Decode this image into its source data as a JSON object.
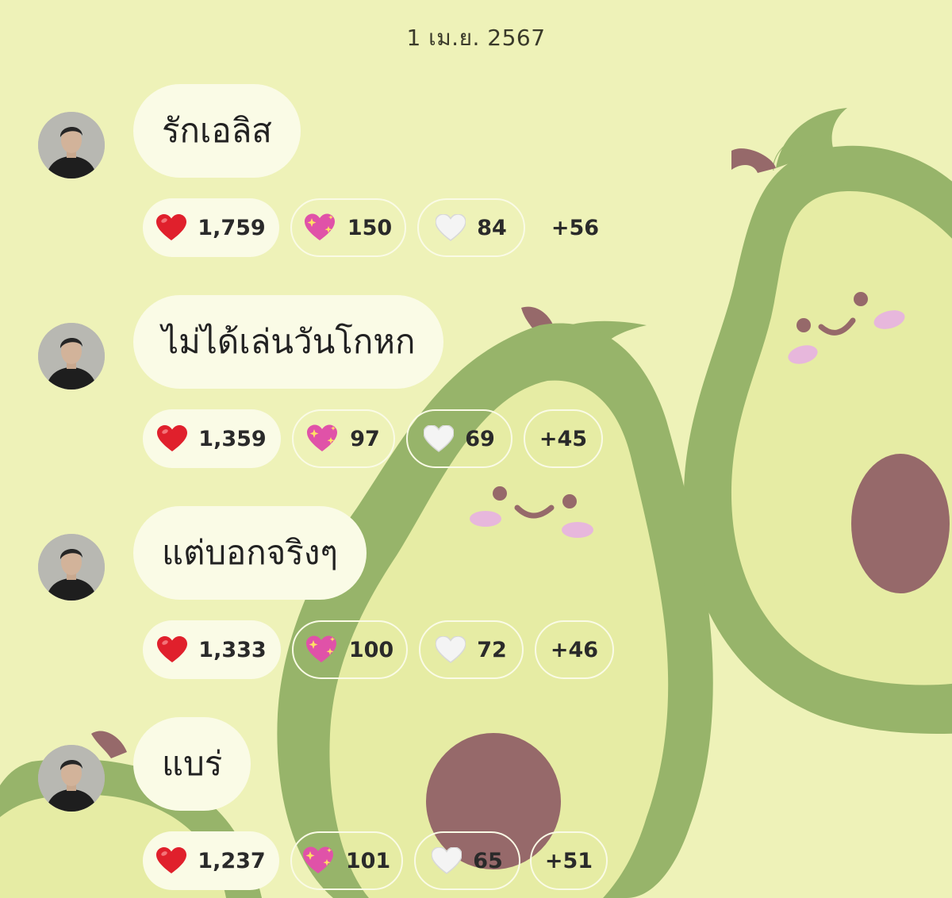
{
  "date": "1 เม.ย. 2567",
  "colors": {
    "background": "#eef2b8",
    "bubble": "#fafbe6",
    "avocado_skin": "#97b46a",
    "avocado_flesh": "#e6eca4",
    "avocado_pit": "#96696a",
    "blush": "#e7b7dc"
  },
  "messages": [
    {
      "text": "รักเอลิส",
      "avatar_icon": "profile-photo",
      "reactions": [
        {
          "icon": "red-heart-icon",
          "count": "1,759"
        },
        {
          "icon": "sparkling-heart-icon",
          "count": "150"
        },
        {
          "icon": "white-heart-icon",
          "count": "84"
        }
      ],
      "more": "+56"
    },
    {
      "text": "ไม่ได้เล่นวันโกหก",
      "avatar_icon": "profile-photo",
      "reactions": [
        {
          "icon": "red-heart-icon",
          "count": "1,359"
        },
        {
          "icon": "sparkling-heart-icon",
          "count": "97"
        },
        {
          "icon": "white-heart-icon",
          "count": "69"
        }
      ],
      "more": "+45"
    },
    {
      "text": "แต่บอกจริงๆ",
      "avatar_icon": "profile-photo",
      "reactions": [
        {
          "icon": "red-heart-icon",
          "count": "1,333"
        },
        {
          "icon": "sparkling-heart-icon",
          "count": "100"
        },
        {
          "icon": "white-heart-icon",
          "count": "72"
        }
      ],
      "more": "+46"
    },
    {
      "text": "แบร่",
      "avatar_icon": "profile-photo",
      "reactions": [
        {
          "icon": "red-heart-icon",
          "count": "1,237"
        },
        {
          "icon": "sparkling-heart-icon",
          "count": "101"
        },
        {
          "icon": "white-heart-icon",
          "count": "65"
        }
      ],
      "more": "+51"
    }
  ]
}
